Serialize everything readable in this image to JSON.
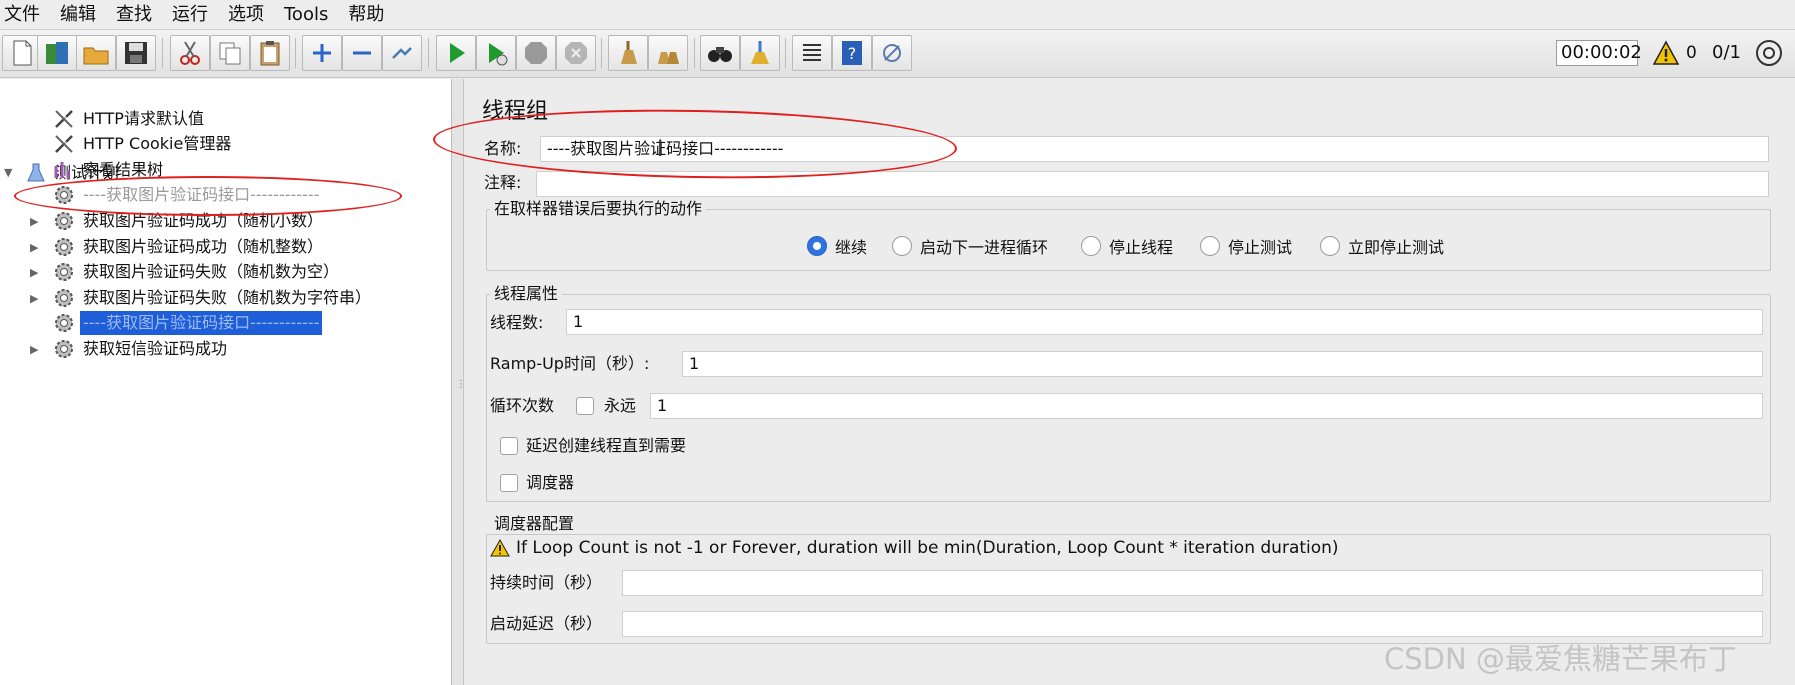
{
  "menu": [
    "文件",
    "编辑",
    "查找",
    "运行",
    "选项",
    "Tools",
    "帮助"
  ],
  "toolbar": {
    "timer": "00:00:02",
    "warning_count": "0",
    "threads": "0/1"
  },
  "tree": {
    "root": "测试计划",
    "items": [
      {
        "label": "HTTP请求默认值"
      },
      {
        "label": "HTTP Cookie管理器"
      },
      {
        "label": "察看结果树"
      },
      {
        "label": "----获取图片验证码接口------------"
      },
      {
        "label": "获取图片验证码成功（随机小数）"
      },
      {
        "label": "获取图片验证码成功（随机整数）"
      },
      {
        "label": "获取图片验证码失败（随机数为空）"
      },
      {
        "label": "获取图片验证码失败（随机数为字符串）"
      },
      {
        "label": "----获取图片验证码接口------------"
      },
      {
        "label": "获取短信验证码成功"
      }
    ]
  },
  "panel": {
    "title": "线程组",
    "name_label": "名称:",
    "name_value": "----获取图片验证码接口------------",
    "comment_label": "注释:",
    "comment_value": "",
    "error_group_title": "在取样器错误后要执行的动作",
    "error_options": [
      "继续",
      "启动下一进程循环",
      "停止线程",
      "停止测试",
      "立即停止测试"
    ],
    "thread_group_title": "线程属性",
    "threads_label": "线程数:",
    "threads_value": "1",
    "rampup_label": "Ramp-Up时间（秒）:",
    "rampup_value": "1",
    "loop_label": "循环次数",
    "forever_label": "永远",
    "loop_value": "1",
    "delay_label": "延迟创建线程直到需要",
    "scheduler_label": "调度器",
    "scheduler_group_title": "调度器配置",
    "scheduler_note": "If Loop Count is not -1 or Forever, duration will be min(Duration, Loop Count * iteration duration)",
    "duration_label": "持续时间（秒）",
    "duration_value": "",
    "startup_delay_label": "启动延迟（秒）",
    "startup_delay_value": ""
  },
  "watermark": "CSDN @最爱焦糖芒果布丁",
  "colors": {
    "selection": "#1e5ed8",
    "annotation": "#e0201f",
    "radio_on": "#2f73e0"
  }
}
